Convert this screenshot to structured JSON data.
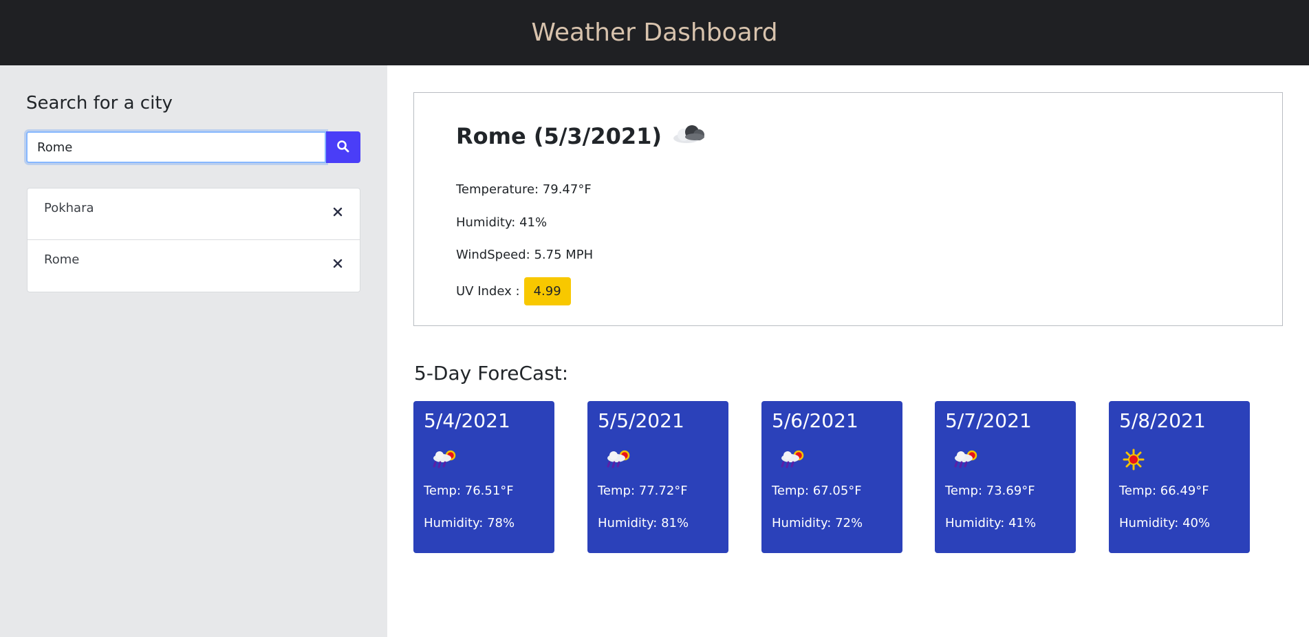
{
  "header": {
    "title": "Weather Dashboard"
  },
  "sidebar": {
    "heading": "Search for a city",
    "search": {
      "value": "Rome",
      "placeholder": "",
      "button_icon": "search-icon"
    },
    "history": [
      {
        "city": "Pokhara",
        "remove_icon": "close-icon"
      },
      {
        "city": "Rome",
        "remove_icon": "close-icon"
      }
    ]
  },
  "current": {
    "title": "Rome (5/3/2021)",
    "icon": "cloud-icon",
    "temperature": "Temperature: 79.47°F",
    "humidity": "Humidity: 41%",
    "wind": "WindSpeed: 5.75 MPH",
    "uv_label": "UV Index :",
    "uv_value": "4.99",
    "uv_color": "#f8c800"
  },
  "forecast": {
    "title": "5-Day ForeCast:",
    "days": [
      {
        "date": "5/4/2021",
        "icon": "rain-sun-icon",
        "temp": "Temp: 76.51°F",
        "humidity": "Humidity: 78%"
      },
      {
        "date": "5/5/2021",
        "icon": "rain-sun-icon",
        "temp": "Temp: 77.72°F",
        "humidity": "Humidity: 81%"
      },
      {
        "date": "5/6/2021",
        "icon": "rain-sun-icon",
        "temp": "Temp: 67.05°F",
        "humidity": "Humidity: 72%"
      },
      {
        "date": "5/7/2021",
        "icon": "rain-sun-icon",
        "temp": "Temp: 73.69°F",
        "humidity": "Humidity: 41%"
      },
      {
        "date": "5/8/2021",
        "icon": "sun-icon",
        "temp": "Temp: 66.49°F",
        "humidity": "Humidity: 40%"
      }
    ]
  },
  "colors": {
    "header_bg": "#1f2023",
    "title_color": "#d8c3ad",
    "accent_button": "#4a3ef7",
    "card_bg": "#2b41ba"
  }
}
